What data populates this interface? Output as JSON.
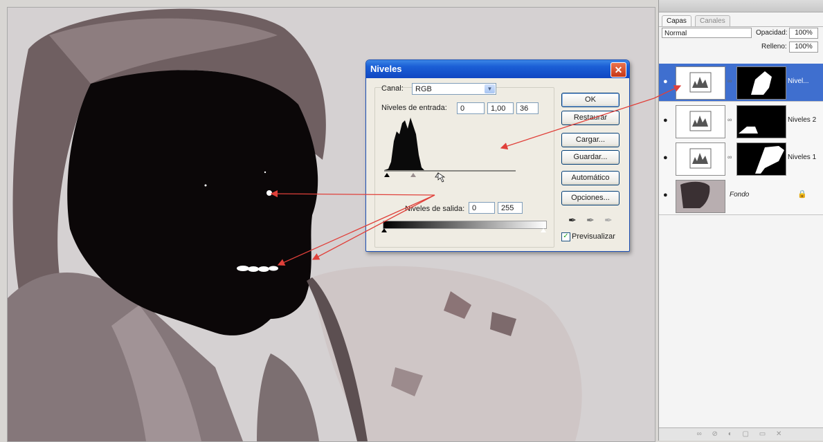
{
  "dialog": {
    "title": "Niveles",
    "close_icon": "close-icon",
    "channel_label": "Canal:",
    "channel_value": "RGB",
    "input_levels_label": "Niveles de entrada:",
    "input_black": "0",
    "input_gamma": "1,00",
    "input_white": "36",
    "output_levels_label": "Niveles de salida:",
    "output_black": "0",
    "output_white": "255",
    "buttons": {
      "ok": "OK",
      "reset": "Restaurar",
      "load": "Cargar...",
      "save": "Guardar...",
      "auto": "Automático",
      "options": "Opciones..."
    },
    "preview_label": "Previsualizar",
    "preview_checked": true
  },
  "layers_panel": {
    "tabs": [
      "Capas",
      "Canales"
    ],
    "blend_mode": "Normal",
    "opacity_label": "Opacidad:",
    "opacity_value": "100%",
    "fill_label": "Relleno:",
    "fill_value": "100%",
    "layers": [
      {
        "name": "Nivel...",
        "selected": true
      },
      {
        "name": "Niveles 2",
        "selected": false
      },
      {
        "name": "Niveles 1",
        "selected": false
      },
      {
        "name": "Fondo",
        "selected": false
      }
    ]
  },
  "colors": {
    "title_bar": "#1b5fd6",
    "close_button": "#c63616",
    "selected_layer": "#3f6fcf",
    "annotation_arrow": "#e0403a"
  }
}
